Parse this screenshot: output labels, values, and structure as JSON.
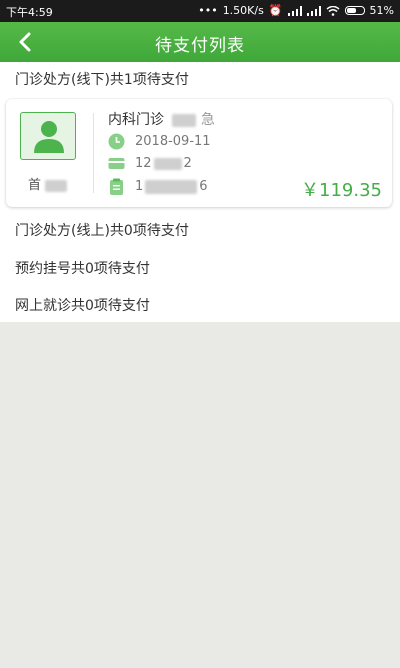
{
  "status_bar": {
    "time": "下午4:59",
    "network_speed": "1.50K/s",
    "battery": "51%"
  },
  "header": {
    "title": "待支付列表"
  },
  "sections": {
    "offline_prescription": "门诊处方(线下)共1项待支付",
    "online_prescription": "门诊处方(线上)共0项待支付",
    "appointment": "预约挂号共0项待支付",
    "online_consult": "网上就诊共0项待支付"
  },
  "card": {
    "patient_name": "首",
    "department": "内科门诊",
    "department_suffix": "急",
    "date": "2018-09-11",
    "card_number_prefix": "12",
    "card_number_suffix": "2",
    "order_number_prefix": "1",
    "order_number_suffix": "6",
    "amount": "￥119.35"
  },
  "colors": {
    "accent": "#45ad47",
    "header_bg": "#4cb342",
    "status_bar_bg": "#1b1b1b",
    "page_bg": "#e9e9e6"
  },
  "icons": {
    "back": "chevron-left-icon",
    "avatar": "person-icon",
    "date": "clock-icon",
    "card": "card-icon",
    "order": "clipboard-icon"
  }
}
